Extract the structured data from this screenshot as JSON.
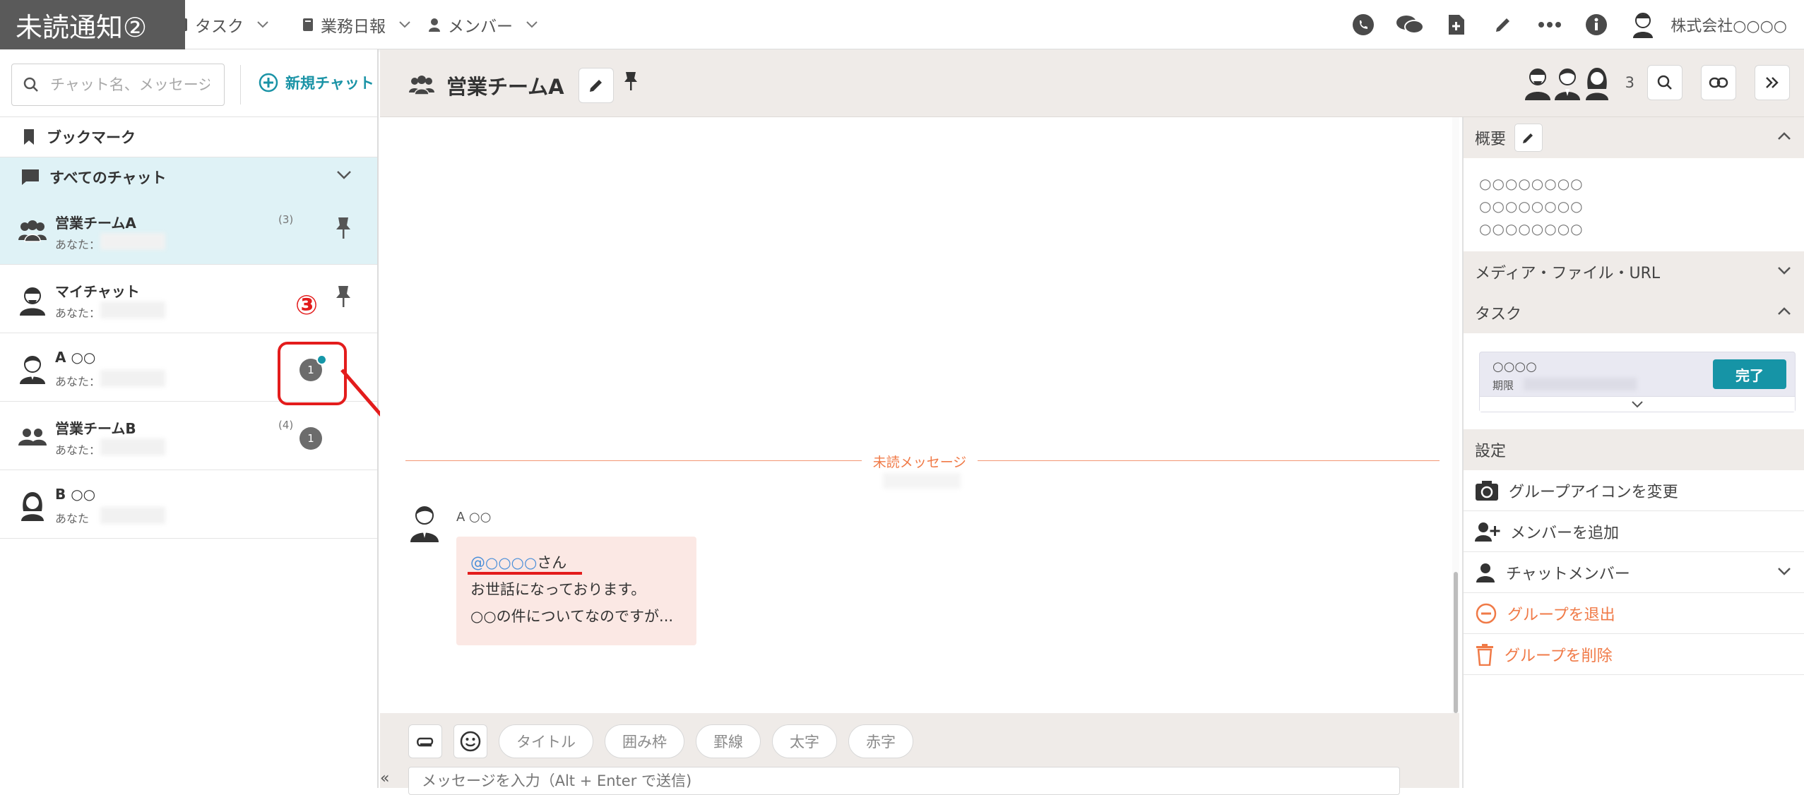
{
  "annotation": {
    "title": "未読通知②",
    "step_number": "③"
  },
  "topnav": {
    "task_label": "タスク",
    "daily_report_label": "業務日報",
    "members_label": "メンバー",
    "company_name": "株式会社○○○○",
    "icons": [
      "phone-icon",
      "chat-bubbles-icon",
      "new-document-icon",
      "pencil-icon",
      "more-dots-icon",
      "info-icon",
      "user-avatar-icon"
    ]
  },
  "sidebar": {
    "search_placeholder": "チャット名、メッセージ...",
    "new_chat_label": "新規チャット",
    "bookmark_label": "ブックマーク",
    "all_chats_label": "すべてのチャット",
    "chats": [
      {
        "name": "営業チームA",
        "preview": "あなた：",
        "count": "(3)",
        "pinned": true,
        "active": true
      },
      {
        "name": "マイチャット",
        "preview": "あなた：",
        "pinned": true
      },
      {
        "name": "A ○○",
        "preview": "あなた：",
        "unread": "1",
        "mention_dot": true
      },
      {
        "name": "営業チームB",
        "preview": "あなた：",
        "count": "(4)",
        "unread": "1"
      },
      {
        "name": "B ○○",
        "preview": "あなた"
      }
    ]
  },
  "chat_header": {
    "room_name": "営業チームA",
    "member_count": "3"
  },
  "messages": {
    "unread_divider": "未読メッセージ",
    "sender": "A ○○",
    "mention": "@○○○○",
    "mention_suffix": "さん",
    "line2": "お世話になっております。",
    "line3": "○○の件についてなのですが..."
  },
  "composer": {
    "buttons": [
      "タイトル",
      "囲み枠",
      "罫線",
      "太字",
      "赤字"
    ],
    "placeholder": "メッセージを入力（Alt + Enter で送信)",
    "collapse_label": "«"
  },
  "right_panel": {
    "overview_title": "概要",
    "overview_lines": [
      "○○○○○○○○",
      "○○○○○○○○",
      "○○○○○○○○"
    ],
    "media_title": "メディア・ファイル・URL",
    "task_title": "タスク",
    "task_name": "○○○○",
    "task_due_label": "期限",
    "task_done_label": "完了",
    "settings_title": "設定",
    "change_icon_label": "グループアイコンを変更",
    "add_member_label": "メンバーを追加",
    "chat_members_label": "チャットメンバー",
    "leave_group_label": "グループを退出",
    "delete_group_label": "グループを削除"
  },
  "colors": {
    "accent": "#1694a6",
    "active_bg": "#dff2f6",
    "danger": "#f07a47",
    "annotation_red": "#e31c1c",
    "bubble_bg": "#fbe8e4"
  }
}
